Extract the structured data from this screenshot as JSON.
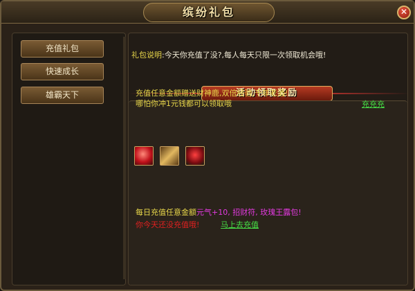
{
  "window": {
    "title": "缤纷礼包",
    "close_label": "✕"
  },
  "sidebar": {
    "items": [
      {
        "label": "充值礼包"
      },
      {
        "label": "快速成长"
      },
      {
        "label": "雄霸天下"
      }
    ]
  },
  "main": {
    "desc_label": "礼包说明",
    "desc_text": ":今天你充值了没?,每人每天只限一次领取机会哦!",
    "section_title": "活动领取奖励",
    "line1": "充值任意金额赠送财神鹿,双倍经验,千年老酒!",
    "line2": "哪怕你冲1元钱都可以领取哦",
    "link1": "充充充",
    "reward_prefix": "每日充值任意金额",
    "reward_items": "元气+10, 招财符, 玫瑰王露包!",
    "warn": "你今天还没充值哦!",
    "link2": "马上去充值"
  },
  "icons": [
    "red-orb-icon",
    "scroll-icon",
    "rose-bouquet-icon"
  ]
}
